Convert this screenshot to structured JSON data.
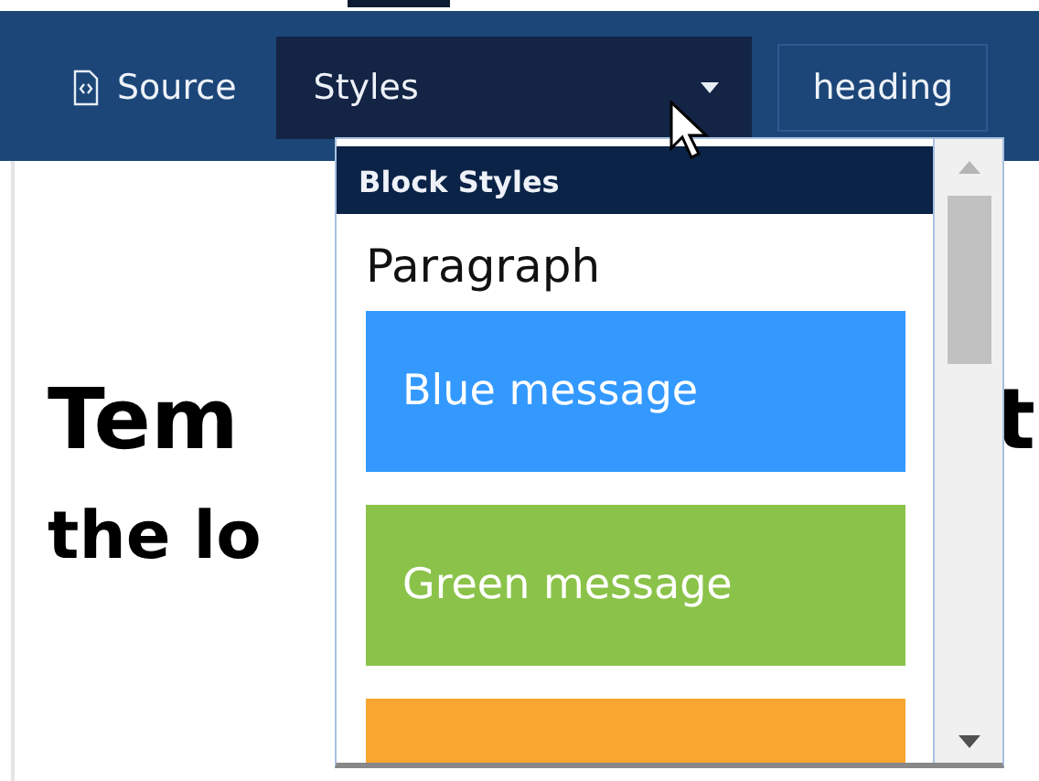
{
  "toolbar": {
    "source_button": {
      "label": "Source"
    },
    "styles_combo": {
      "label": "Styles",
      "expanded": true
    },
    "format_combo": {
      "label": "heading"
    }
  },
  "editor": {
    "heading_start": "Tem",
    "heading_end": "t",
    "subheading": "the lo"
  },
  "styles_menu": {
    "group_title": "Block Styles",
    "items": [
      {
        "kind": "paragraph",
        "label": "Paragraph"
      },
      {
        "kind": "message",
        "label": "Blue message",
        "color": "#3399ff"
      },
      {
        "kind": "message",
        "label": "Green message",
        "color": "#8bc34a"
      },
      {
        "kind": "message",
        "color": "#f9a630"
      }
    ]
  }
}
